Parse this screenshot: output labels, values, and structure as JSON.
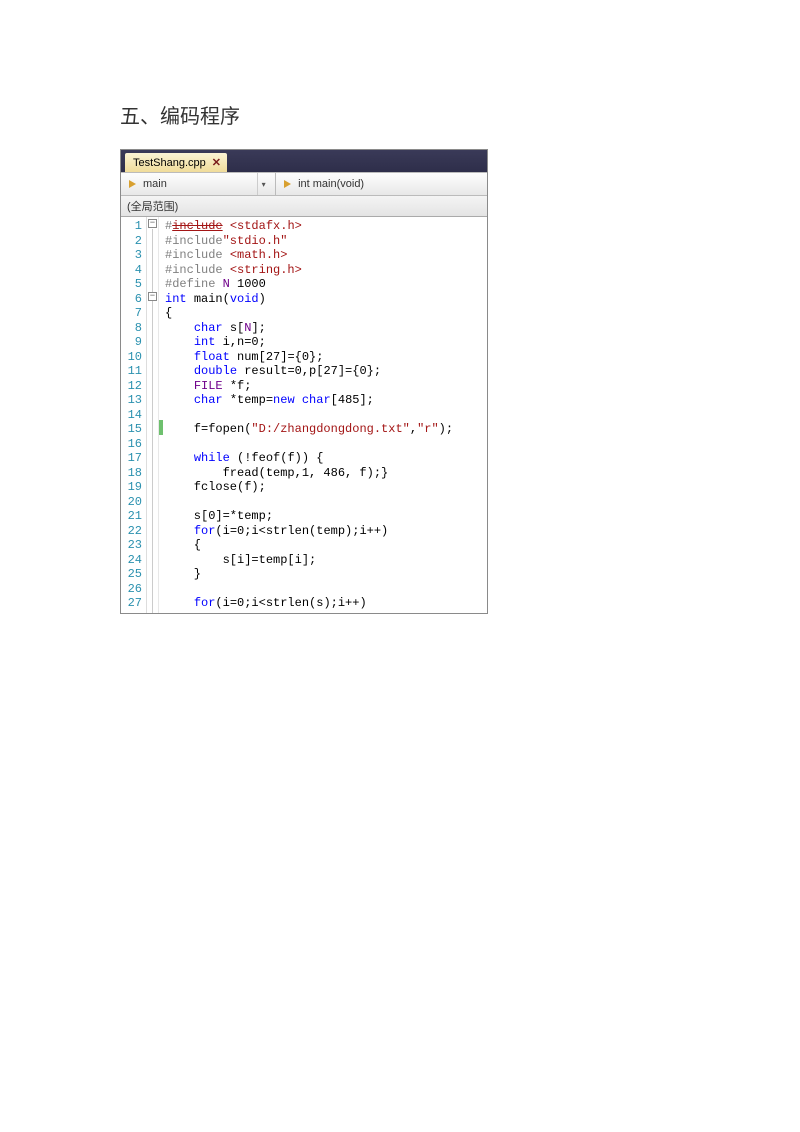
{
  "heading": "五、编码程序",
  "tab": {
    "filename": "TestShang.cpp",
    "close": "✕"
  },
  "nav": {
    "left_label": "main",
    "right_label": "int main(void)",
    "drop": "▾"
  },
  "scope": "(全局范围)",
  "code": {
    "lines": [
      {
        "n": 1,
        "segs": [
          [
            "pp",
            "#"
          ],
          [
            "inc strike",
            "include"
          ],
          [
            "pp",
            " "
          ],
          [
            "file",
            "<stdafx.h>"
          ]
        ]
      },
      {
        "n": 2,
        "segs": [
          [
            "pp",
            "#include"
          ],
          [
            "str",
            "\"stdio.h\""
          ]
        ]
      },
      {
        "n": 3,
        "segs": [
          [
            "pp",
            "#include "
          ],
          [
            "file",
            "<math.h>"
          ]
        ]
      },
      {
        "n": 4,
        "segs": [
          [
            "pp",
            "#include "
          ],
          [
            "file",
            "<string.h>"
          ]
        ]
      },
      {
        "n": 5,
        "segs": [
          [
            "pp",
            "#define "
          ],
          [
            "mac",
            "N"
          ],
          [
            "",
            " 1000"
          ]
        ]
      },
      {
        "n": 6,
        "segs": [
          [
            "kw",
            "int"
          ],
          [
            "",
            " "
          ],
          [
            "fn",
            "main"
          ],
          [
            "",
            "("
          ],
          [
            "kw",
            "void"
          ],
          [
            "",
            ")"
          ]
        ]
      },
      {
        "n": 7,
        "segs": [
          [
            "",
            "{"
          ]
        ]
      },
      {
        "n": 8,
        "segs": [
          [
            "",
            "    "
          ],
          [
            "kw",
            "char"
          ],
          [
            "",
            " s["
          ],
          [
            "mac",
            "N"
          ],
          [
            "",
            "];"
          ]
        ]
      },
      {
        "n": 9,
        "segs": [
          [
            "",
            "    "
          ],
          [
            "kw",
            "int"
          ],
          [
            "",
            " i,n=0;"
          ]
        ]
      },
      {
        "n": 10,
        "segs": [
          [
            "",
            "    "
          ],
          [
            "kw",
            "float"
          ],
          [
            "",
            " num[27]={0};"
          ]
        ]
      },
      {
        "n": 11,
        "segs": [
          [
            "",
            "    "
          ],
          [
            "kw",
            "double"
          ],
          [
            "",
            " result=0,p[27]={0};"
          ]
        ]
      },
      {
        "n": 12,
        "segs": [
          [
            "",
            "    "
          ],
          [
            "mac",
            "FILE"
          ],
          [
            "",
            " *f;"
          ]
        ]
      },
      {
        "n": 13,
        "segs": [
          [
            "",
            "    "
          ],
          [
            "kw",
            "char"
          ],
          [
            "",
            " *temp="
          ],
          [
            "kw",
            "new"
          ],
          [
            "",
            " "
          ],
          [
            "kw",
            "char"
          ],
          [
            "",
            "[485];"
          ]
        ]
      },
      {
        "n": 14,
        "segs": [
          [
            "",
            ""
          ]
        ]
      },
      {
        "n": 15,
        "segs": [
          [
            "",
            "    f=fopen("
          ],
          [
            "str",
            "\"D:/zhangdongdong.txt\""
          ],
          [
            "",
            ","
          ],
          [
            "str",
            "\"r\""
          ],
          [
            "",
            ");"
          ]
        ]
      },
      {
        "n": 16,
        "segs": [
          [
            "",
            ""
          ]
        ]
      },
      {
        "n": 17,
        "segs": [
          [
            "",
            "    "
          ],
          [
            "kw",
            "while"
          ],
          [
            "",
            " (!feof(f)) {"
          ]
        ]
      },
      {
        "n": 18,
        "segs": [
          [
            "",
            "        fread(temp,1, 486, f);}"
          ]
        ]
      },
      {
        "n": 19,
        "segs": [
          [
            "",
            "    fclose(f);"
          ]
        ]
      },
      {
        "n": 20,
        "segs": [
          [
            "",
            ""
          ]
        ]
      },
      {
        "n": 21,
        "segs": [
          [
            "",
            "    s[0]=*temp;"
          ]
        ]
      },
      {
        "n": 22,
        "segs": [
          [
            "",
            "    "
          ],
          [
            "kw",
            "for"
          ],
          [
            "",
            "(i=0;i<strlen(temp);i++)"
          ]
        ]
      },
      {
        "n": 23,
        "segs": [
          [
            "",
            "    {"
          ]
        ]
      },
      {
        "n": 24,
        "segs": [
          [
            "",
            "        s[i]=temp[i];"
          ]
        ]
      },
      {
        "n": 25,
        "segs": [
          [
            "",
            "    }"
          ]
        ]
      },
      {
        "n": 26,
        "segs": [
          [
            "",
            ""
          ]
        ]
      },
      {
        "n": 27,
        "segs": [
          [
            "",
            "    "
          ],
          [
            "kw",
            "for"
          ],
          [
            "",
            "(i=0;i<strlen(s);i++)"
          ]
        ]
      }
    ]
  }
}
